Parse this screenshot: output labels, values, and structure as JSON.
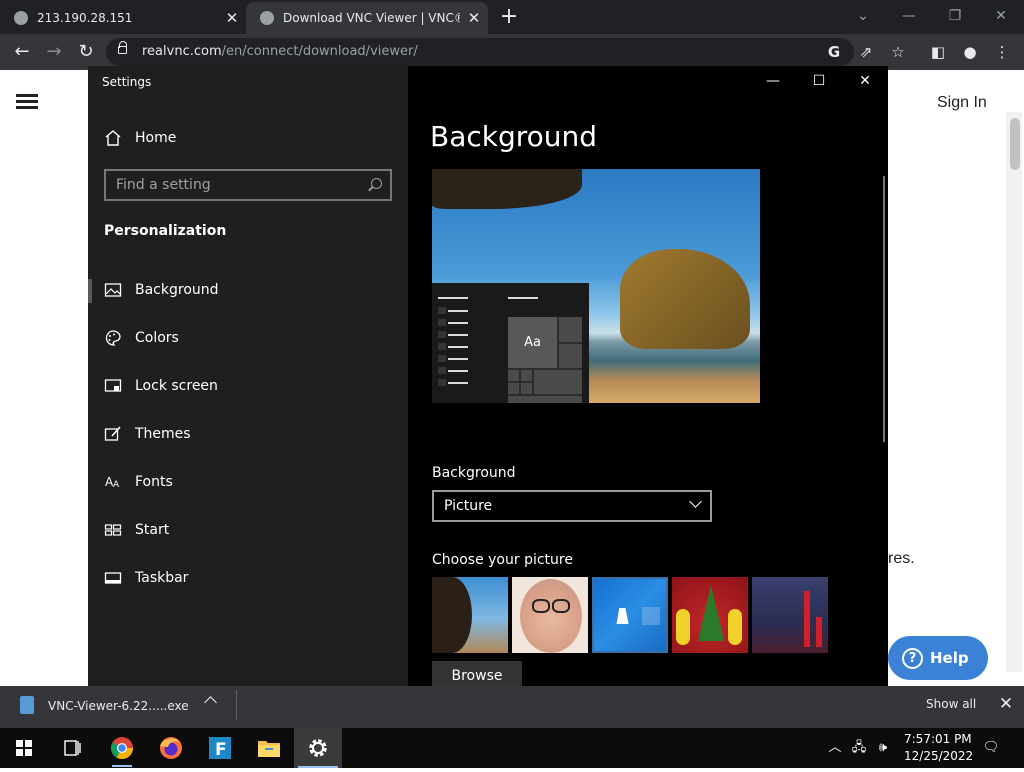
{
  "browser": {
    "tabs": [
      {
        "title": "213.190.28.151"
      },
      {
        "title": "Download VNC Viewer | VNC® C"
      }
    ],
    "url_host": "realvnc.com",
    "url_path": "/en/connect/download/viewer/",
    "new_tab_icon": "plus-icon"
  },
  "page": {
    "signin": "Sign In",
    "partial_text": "res.",
    "help_button": "Help",
    "help_glyph": "?"
  },
  "settings": {
    "window_title": "Settings",
    "home_label": "Home",
    "search_placeholder": "Find a setting",
    "section_title": "Personalization",
    "nav": [
      {
        "label": "Background",
        "icon": "image-icon"
      },
      {
        "label": "Colors",
        "icon": "palette-icon"
      },
      {
        "label": "Lock screen",
        "icon": "lock-screen-icon"
      },
      {
        "label": "Themes",
        "icon": "themes-icon"
      },
      {
        "label": "Fonts",
        "icon": "fonts-icon"
      },
      {
        "label": "Start",
        "icon": "start-icon"
      },
      {
        "label": "Taskbar",
        "icon": "taskbar-icon"
      }
    ],
    "page_title": "Background",
    "preview_tile_text": "Aa",
    "background_label": "Background",
    "background_value": "Picture",
    "choose_label": "Choose your picture",
    "browse_label": "Browse"
  },
  "download_bar": {
    "filename": "VNC-Viewer-6.22.....exe",
    "show_all": "Show all"
  },
  "taskbar": {
    "time": "7:57:01 PM",
    "date": "12/25/2022"
  }
}
